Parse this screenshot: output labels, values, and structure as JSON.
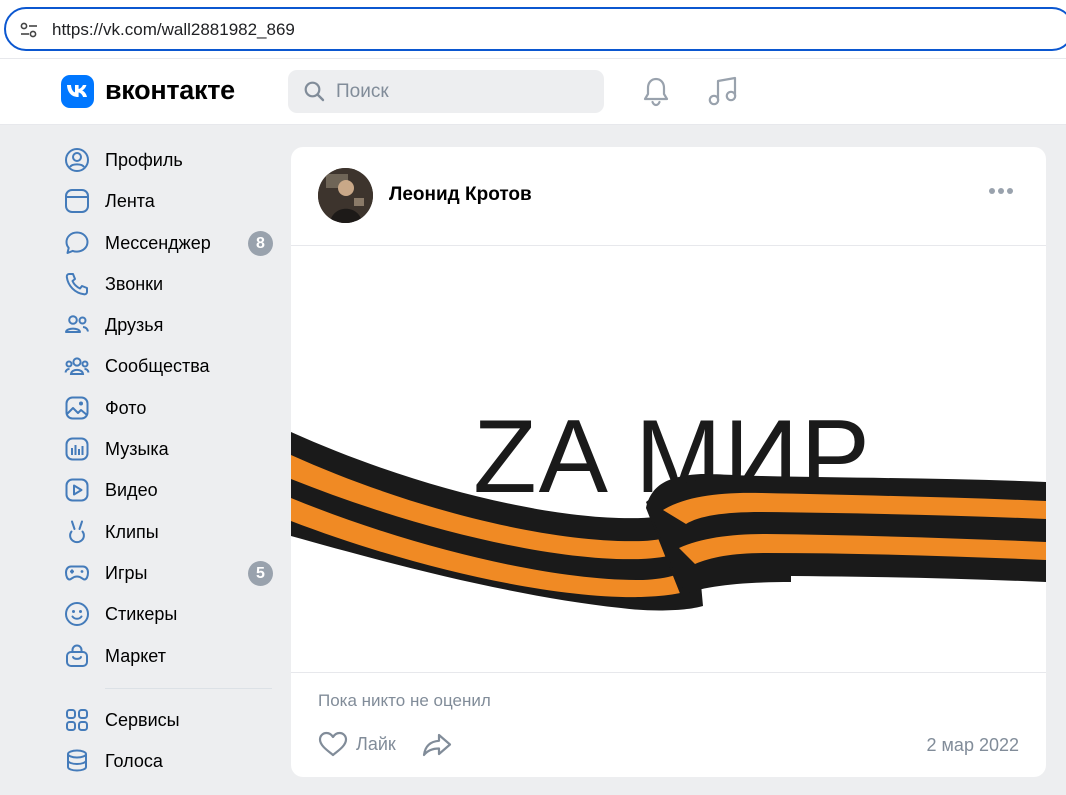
{
  "browser": {
    "url": "https://vk.com/wall2881982_869"
  },
  "header": {
    "logo_text": "вконтакте",
    "search_placeholder": "Поиск",
    "accent_color": "#0077ff"
  },
  "sidebar": {
    "items": [
      {
        "label": "Профиль",
        "icon": "profile-icon"
      },
      {
        "label": "Лента",
        "icon": "feed-icon"
      },
      {
        "label": "Мессенджер",
        "icon": "messenger-icon",
        "badge": "8"
      },
      {
        "label": "Звонки",
        "icon": "phone-icon"
      },
      {
        "label": "Друзья",
        "icon": "friends-icon"
      },
      {
        "label": "Сообщества",
        "icon": "communities-icon"
      },
      {
        "label": "Фото",
        "icon": "photo-icon"
      },
      {
        "label": "Музыка",
        "icon": "music-icon"
      },
      {
        "label": "Видео",
        "icon": "video-icon"
      },
      {
        "label": "Клипы",
        "icon": "clips-icon"
      },
      {
        "label": "Игры",
        "icon": "games-icon",
        "badge": "5"
      },
      {
        "label": "Стикеры",
        "icon": "stickers-icon"
      },
      {
        "label": "Маркет",
        "icon": "market-icon"
      }
    ],
    "extra_items": [
      {
        "label": "Сервисы",
        "icon": "services-icon"
      },
      {
        "label": "Голоса",
        "icon": "votes-icon"
      }
    ]
  },
  "post": {
    "author": "Леонид Кротов",
    "image_text": "ZA МИР",
    "likes_summary": "Пока никто не оценил",
    "like_label": "Лайк",
    "date": "2 мар 2022",
    "ribbon_colors": {
      "orange": "#f08a24",
      "black": "#1a1a1a"
    }
  }
}
